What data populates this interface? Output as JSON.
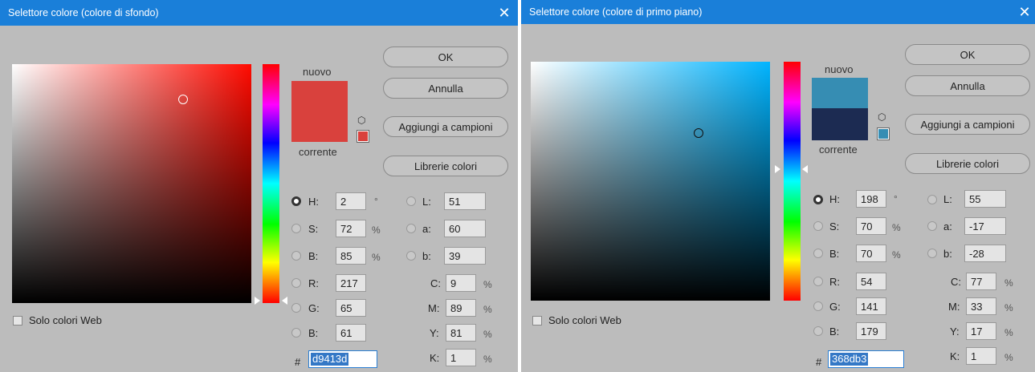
{
  "dialogs": [
    {
      "title": "Selettore colore (colore di sfondo)",
      "hue_color": "#ff0a00",
      "new_color": "#d9413d",
      "current_color": "#d9413d",
      "swatch_label_new": "nuovo",
      "swatch_label_current": "corrente",
      "buttons": {
        "ok": "OK",
        "cancel": "Annulla",
        "add": "Aggiungi a campioni",
        "libraries": "Librerie colori"
      },
      "web_colors_label": "Solo colori Web",
      "hsb": [
        {
          "label": "H:",
          "value": "2",
          "unit": "°",
          "selected": true
        },
        {
          "label": "S:",
          "value": "72",
          "unit": "%",
          "selected": false
        },
        {
          "label": "B:",
          "value": "85",
          "unit": "%",
          "selected": false
        }
      ],
      "rgb": [
        {
          "label": "R:",
          "value": "217",
          "selected": false
        },
        {
          "label": "G:",
          "value": "65",
          "selected": false
        },
        {
          "label": "B:",
          "value": "61",
          "selected": false
        }
      ],
      "lab": [
        {
          "label": "L:",
          "value": "51",
          "selected": false
        },
        {
          "label": "a:",
          "value": "60",
          "selected": false
        },
        {
          "label": "b:",
          "value": "39",
          "selected": false
        }
      ],
      "cmyk": [
        {
          "label": "C:",
          "value": "9",
          "unit": "%"
        },
        {
          "label": "M:",
          "value": "89",
          "unit": "%"
        },
        {
          "label": "Y:",
          "value": "81",
          "unit": "%"
        },
        {
          "label": "K:",
          "value": "1",
          "unit": "%"
        }
      ],
      "hex_prefix": "#",
      "hex": "d9413d",
      "close_glyph": "✕"
    },
    {
      "title": "Selettore colore (colore di primo piano)",
      "hue_color": "#00b4ff",
      "new_color": "#368db3",
      "current_color": "#1c2b52",
      "swatch_label_new": "nuovo",
      "swatch_label_current": "corrente",
      "buttons": {
        "ok": "OK",
        "cancel": "Annulla",
        "add": "Aggiungi a campioni",
        "libraries": "Librerie colori"
      },
      "web_colors_label": "Solo colori Web",
      "hsb": [
        {
          "label": "H:",
          "value": "198",
          "unit": "°",
          "selected": true
        },
        {
          "label": "S:",
          "value": "70",
          "unit": "%",
          "selected": false
        },
        {
          "label": "B:",
          "value": "70",
          "unit": "%",
          "selected": false
        }
      ],
      "rgb": [
        {
          "label": "R:",
          "value": "54",
          "selected": false
        },
        {
          "label": "G:",
          "value": "141",
          "selected": false
        },
        {
          "label": "B:",
          "value": "179",
          "selected": false
        }
      ],
      "lab": [
        {
          "label": "L:",
          "value": "55",
          "selected": false
        },
        {
          "label": "a:",
          "value": "-17",
          "selected": false
        },
        {
          "label": "b:",
          "value": "-28",
          "selected": false
        }
      ],
      "cmyk": [
        {
          "label": "C:",
          "value": "77",
          "unit": "%"
        },
        {
          "label": "M:",
          "value": "33",
          "unit": "%"
        },
        {
          "label": "Y:",
          "value": "17",
          "unit": "%"
        },
        {
          "label": "K:",
          "value": "1",
          "unit": "%"
        }
      ],
      "hex_prefix": "#",
      "hex": "368db3",
      "close_glyph": "✕"
    }
  ]
}
